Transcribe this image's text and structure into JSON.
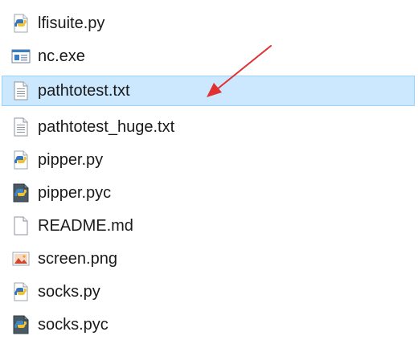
{
  "files": [
    {
      "name": "lfisuite.py",
      "icon": "python-script-icon"
    },
    {
      "name": "nc.exe",
      "icon": "executable-icon"
    },
    {
      "name": "pathtotest.txt",
      "icon": "text-file-icon",
      "selected": true
    },
    {
      "name": "pathtotest_huge.txt",
      "icon": "text-file-icon"
    },
    {
      "name": "pipper.py",
      "icon": "python-script-icon"
    },
    {
      "name": "pipper.pyc",
      "icon": "python-compiled-icon"
    },
    {
      "name": "README.md",
      "icon": "blank-file-icon"
    },
    {
      "name": "screen.png",
      "icon": "image-file-icon"
    },
    {
      "name": "socks.py",
      "icon": "python-script-icon"
    },
    {
      "name": "socks.pyc",
      "icon": "python-compiled-icon"
    }
  ],
  "colors": {
    "selection_fill": "#cce8ff",
    "selection_border": "#99d1ff",
    "annotation_arrow": "#e03030"
  }
}
